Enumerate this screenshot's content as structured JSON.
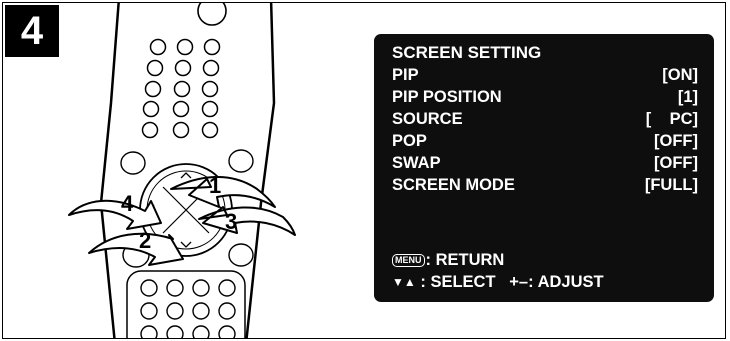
{
  "step": {
    "number": "4"
  },
  "remote": {
    "arrow_labels": [
      "1",
      "2",
      "3",
      "4"
    ]
  },
  "osd": {
    "title": "SCREEN SETTING",
    "rows": [
      {
        "label": "PIP",
        "value": "[ON]"
      },
      {
        "label": "PIP POSITION",
        "value": "[1]"
      },
      {
        "label": "SOURCE",
        "value": "[    PC]"
      },
      {
        "label": "POP",
        "value": "[OFF]"
      },
      {
        "label": "SWAP",
        "value": "[OFF]"
      },
      {
        "label": "SCREEN MODE",
        "value": "[FULL]"
      }
    ],
    "footer": {
      "menu_key": "MENU",
      "return_text": ": RETURN",
      "select_icons": "▼▲",
      "select_text": ": SELECT",
      "adjust_icon": "+–",
      "adjust_text": ": ADJUST"
    }
  },
  "colors": {
    "osd_background": "#0e0e0e",
    "osd_text": "#ffffff",
    "ink": "#000000"
  }
}
